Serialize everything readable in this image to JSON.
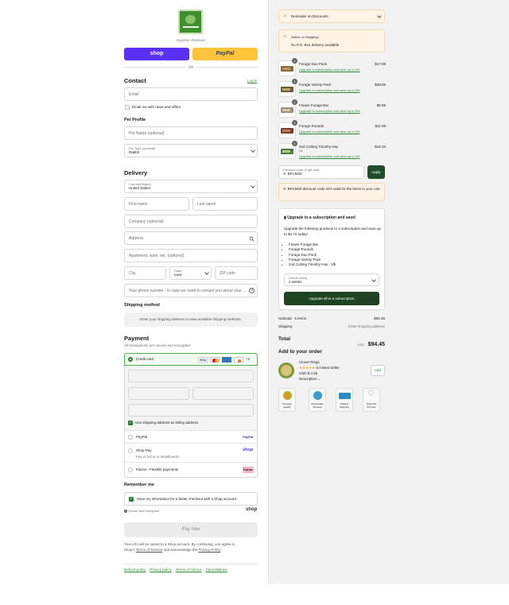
{
  "express": {
    "label": "Express checkout",
    "shop_pay": "shop",
    "paypal": "PayPal",
    "or": "OR"
  },
  "contact": {
    "title": "Contact",
    "login": "Log in",
    "email_placeholder": "Email",
    "news_label": "Email me with news and offers"
  },
  "pet": {
    "title": "Pet Profile",
    "name_placeholder": "Pet Name (optional)",
    "type_label": "Pet Type (optional)",
    "type_value": "Rabbit"
  },
  "delivery": {
    "title": "Delivery",
    "country_label": "Country/Region",
    "country_value": "United States",
    "first_name": "First name",
    "last_name": "Last name",
    "company": "Company (optional)",
    "address": "Address",
    "apartment": "Apartment, suite, etc. (optional)",
    "city": "City",
    "state_label": "State",
    "state_value": "Iowa",
    "zip": "ZIP code",
    "phone": "Your phone number - in case we need to contact you about your ..."
  },
  "shipping_method": {
    "title": "Shipping method",
    "note": "Enter your shipping address to view available shipping methods."
  },
  "payment": {
    "title": "Payment",
    "subtitle": "All transactions are secure and encrypted.",
    "credit_card": "Credit card",
    "card_more": "+5",
    "billing_same": "Use shipping address as billing address",
    "paypal": "PayPal",
    "paypal_logo": "PayPal",
    "shop_pay": "Shop Pay",
    "shop_pay_sub": "Pay in full or in installments",
    "shop_logo": "shop",
    "klarna": "Klarna - Flexible payments",
    "klarna_logo": "Klarna."
  },
  "remember": {
    "title": "Remember me",
    "save_label": "Save my information for a faster checkout with a Shop account",
    "secure": "Secure and encrypted",
    "shop_logo": "shop"
  },
  "pay_now": "Pay now",
  "legal": {
    "line1": "Your info will be saved to a Shop account. By continuing, you agree to",
    "line2_pre": "Shop's",
    "terms": "Terms of Service",
    "line2_mid": "and acknowledge the",
    "privacy": "Privacy Policy"
  },
  "footer_links": [
    "Refund policy",
    "Privacy policy",
    "Terms of service",
    "Cancellations"
  ],
  "banners": {
    "discounts": "Reminder on Discounts",
    "notice_title": "Notice on Shipping!",
    "notice_body": "No P.O. Box delivery available"
  },
  "cart": [
    {
      "qty": "1",
      "name": "Forage Duo Pack",
      "variant": "",
      "price": "$17.99",
      "upgrade": "Upgrade to subscription and save up to 5%"
    },
    {
      "qty": "1",
      "name": "Forage Variety Pack",
      "variant": "",
      "price": "$38.99",
      "upgrade": "Upgrade to subscription and save up to 5%"
    },
    {
      "qty": "1",
      "name": "Flower Forage Bar",
      "variant": "",
      "price": "$8.99",
      "upgrade": "Upgrade to subscription and save up to 5%"
    },
    {
      "qty": "1",
      "name": "Forage Rounds",
      "variant": "",
      "price": "$11.99",
      "upgrade": "Upgrade to subscription and save up to 5%"
    },
    {
      "qty": "1",
      "name": "2nd Cutting Timothy Hay",
      "variant": "2lb",
      "price": "$16.49",
      "upgrade": "Upgrade to subscription and save up to 5%"
    }
  ],
  "discount": {
    "label": "Discount code or gift card",
    "value": "X- BFCM20",
    "apply": "Apply",
    "error": "X- BFCM20 discount code isn't valid for the items in your cart"
  },
  "subscription": {
    "title": "Upgrade to a subscription and save!",
    "desc": "Upgrade the following products to a subscription and save up to $4.72 today!",
    "items": [
      "Flower Forage Bar",
      "Forage Rounds",
      "Forage Duo Pack",
      "Forage Variety Pack",
      "2nd Cutting Timothy Hay - 2lb"
    ],
    "deliver_label": "Deliver every",
    "deliver_value": "4 weeks",
    "button": "Upgrade all to a subscription"
  },
  "totals": {
    "subtotal_label": "Subtotal · 5 items",
    "subtotal": "$94.45",
    "shipping_label": "Shipping",
    "shipping": "Enter shipping address",
    "total_label": "Total",
    "currency": "USD",
    "total": "$94.45"
  },
  "addon": {
    "title": "Add to your order",
    "name": "Clover Rings",
    "rating": "5.0",
    "best": "Best Seller",
    "price": "USD $ 4.50",
    "desc": "Description",
    "add": "Add"
  },
  "badges": [
    "Premium Quality",
    "Sustainably Sourced",
    "Fastest Shipping",
    "Picky Pet Promise"
  ],
  "colors": {
    "shop": "#5a31f4",
    "paypal": "#ffc439",
    "accent": "#2e7d32",
    "apply": "#1f4d2a",
    "sub_button": "#1e4422",
    "notice_bg": "#fff4e5"
  }
}
